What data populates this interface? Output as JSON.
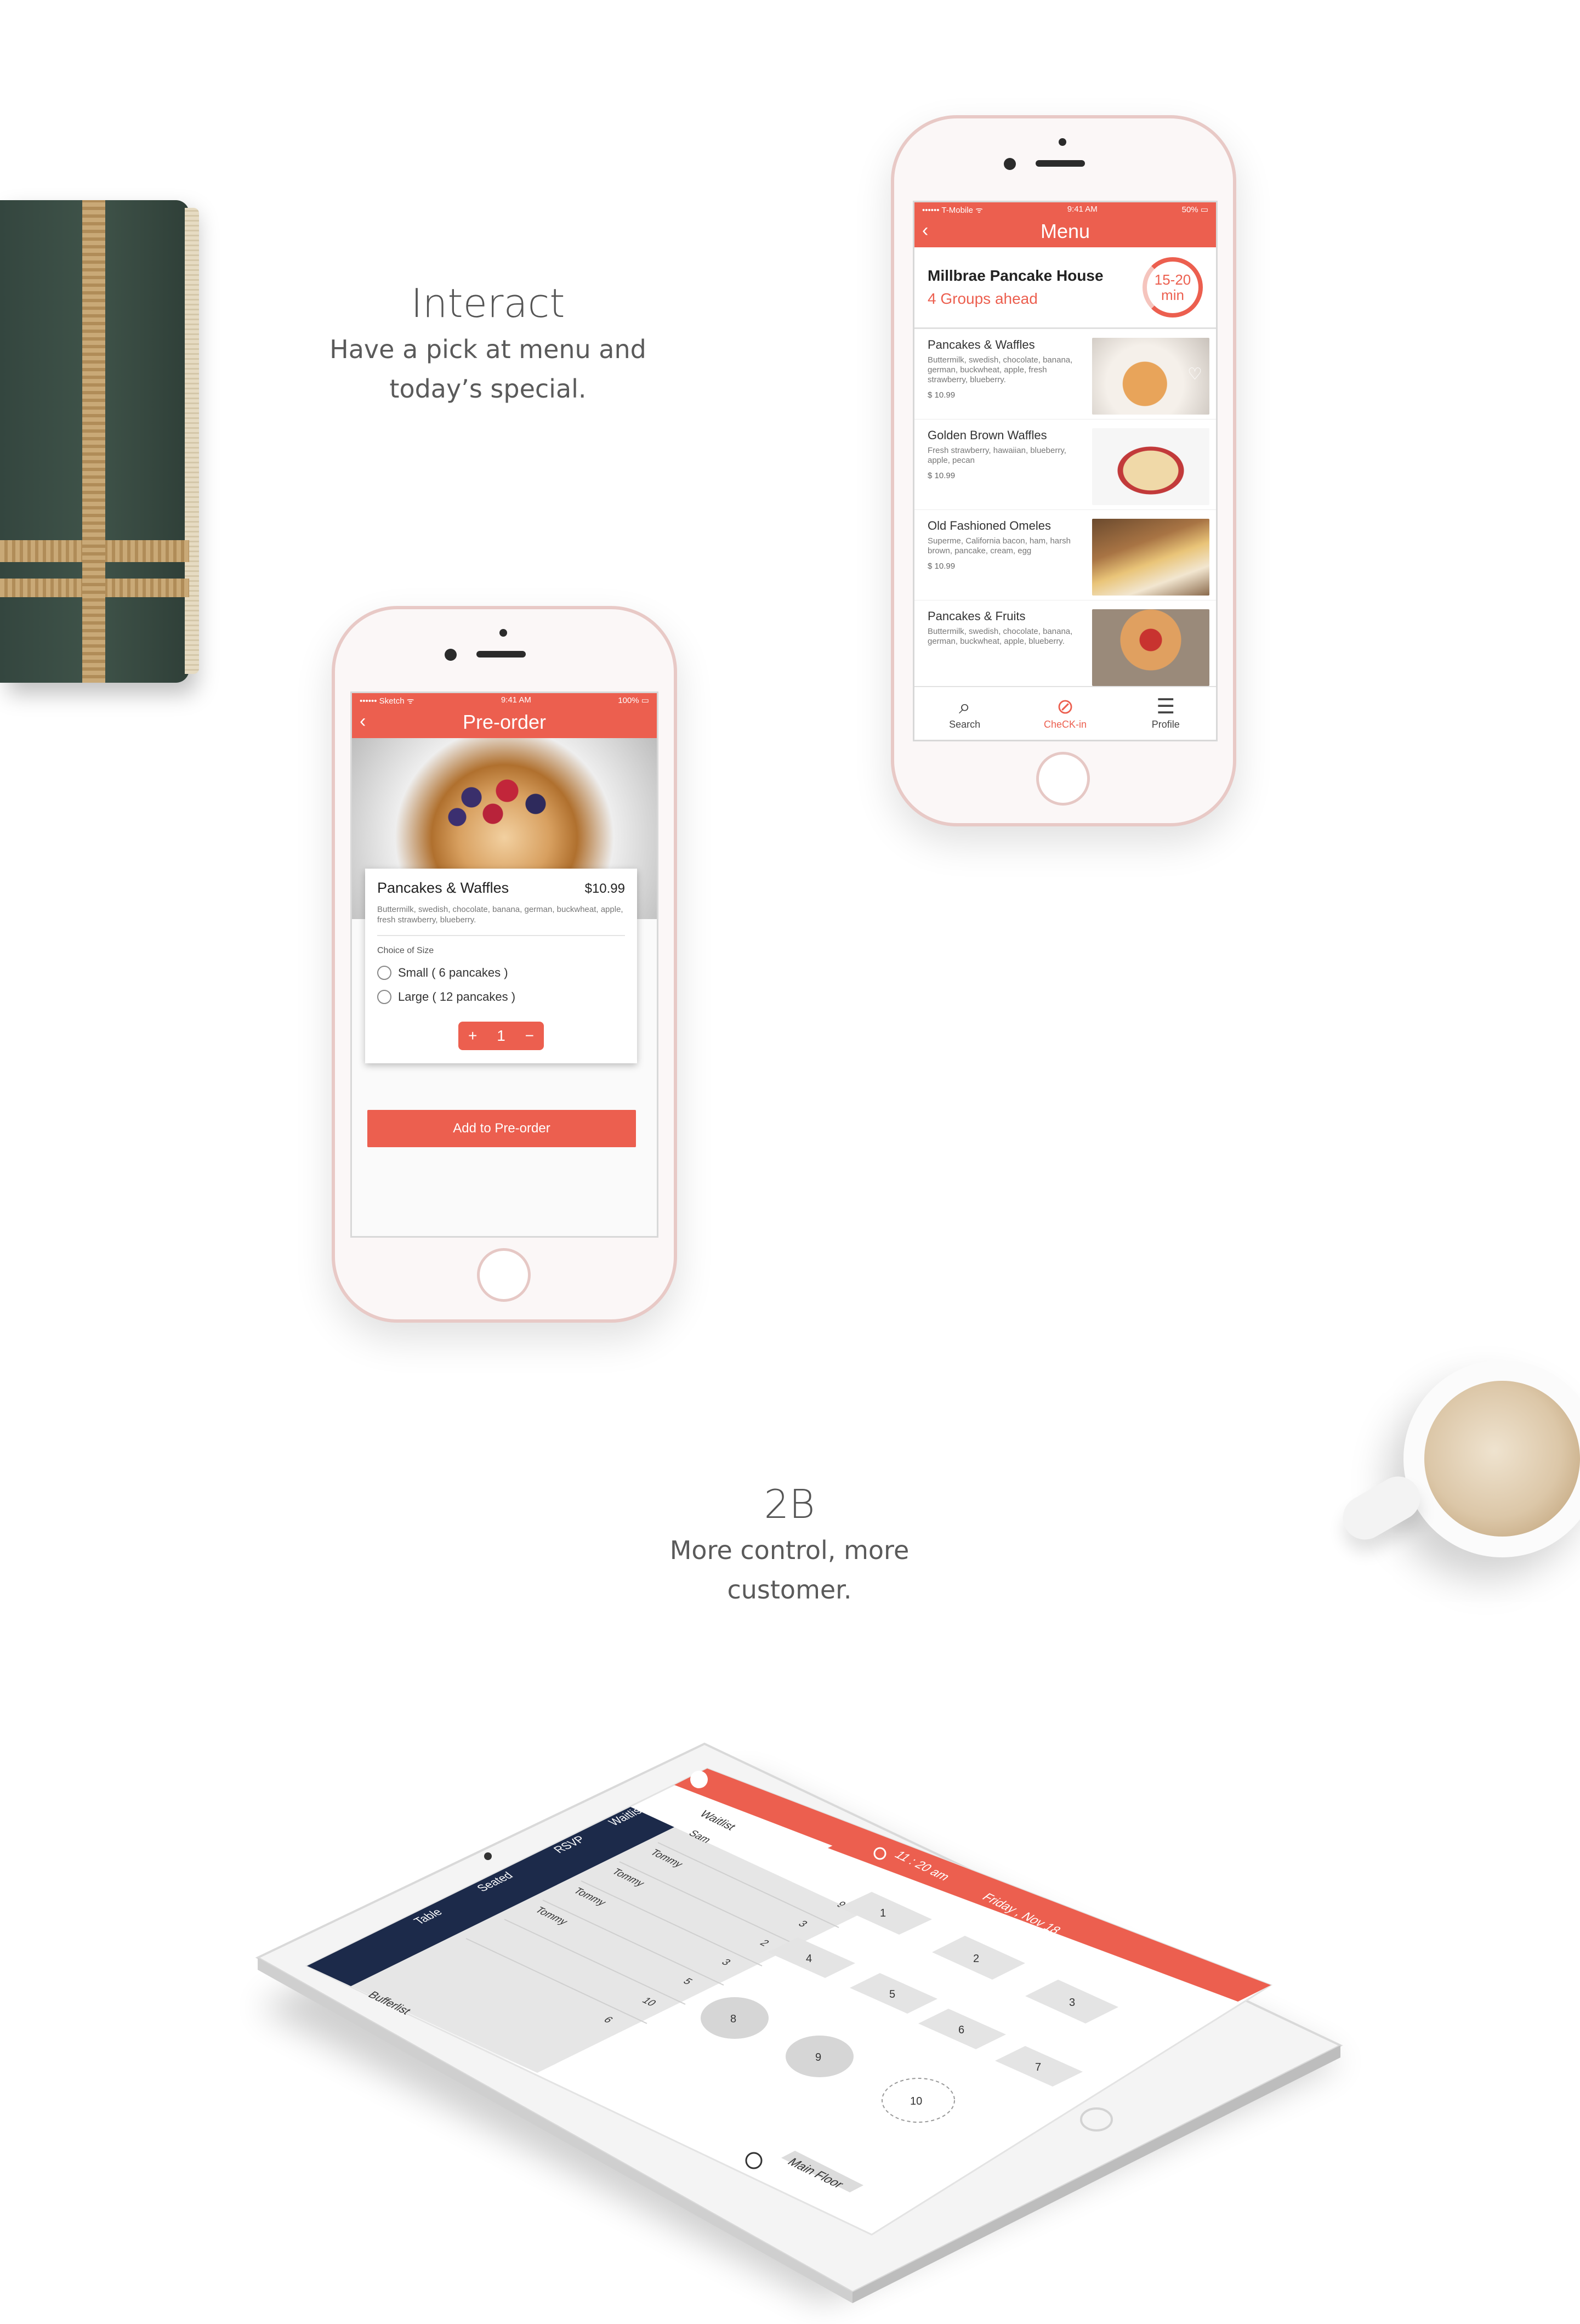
{
  "section1": {
    "title": "Interact",
    "subtitle_line1": "Have a pick at menu and",
    "subtitle_line2": "today’s special."
  },
  "section2": {
    "title": "2B",
    "subtitle_line1": "More control, more",
    "subtitle_line2": "customer."
  },
  "colors": {
    "accent": "#ec5f4f",
    "navy": "#1c2a4a",
    "background": "#ffffff"
  },
  "menu_screen": {
    "status": {
      "carrier": "•••••• T-Mobile ᯤ",
      "time": "9:41 AM",
      "battery": "50% ▭"
    },
    "title": "Menu",
    "back_icon": "chevron-left-icon",
    "restaurant": {
      "name": "Millbrae Pancake House",
      "groups": "4 Groups ahead",
      "wait_line1": "15-20",
      "wait_line2": "min"
    },
    "items": [
      {
        "name": "Pancakes & Waffles",
        "desc": "Buttermilk, swedish, chocolate, banana, german, buckwheat, apple, fresh strawberry, blueberry.",
        "price": "$ 10.99",
        "favorite": true
      },
      {
        "name": "Golden Brown Waffles",
        "desc": "Fresh strawberry, hawaiian, blueberry, apple, pecan",
        "price": "$ 10.99",
        "favorite": false
      },
      {
        "name": "Old Fashioned Omeles",
        "desc": "Superme, California bacon, ham, harsh brown, pancake, cream, egg",
        "price": "$ 10.99",
        "favorite": false
      },
      {
        "name": "Pancakes & Fruits",
        "desc": "Buttermilk, swedish, chocolate, banana, german, buckwheat, apple, blueberry.",
        "price": "",
        "favorite": false
      }
    ],
    "tabs": [
      {
        "label": "Search",
        "icon": "search-icon",
        "active": false
      },
      {
        "label": "CheCK-in",
        "icon": "check-circle-icon",
        "active": true
      },
      {
        "label": "Profile",
        "icon": "menu-lines-icon",
        "active": false
      }
    ]
  },
  "preorder_screen": {
    "status": {
      "carrier": "•••••• Sketch ᯤ",
      "time": "9:41 AM",
      "battery": "100% ▭"
    },
    "title": "Pre-order",
    "item_name": "Pancakes & Waffles",
    "item_price": "$10.99",
    "item_desc": "Buttermilk, swedish, chocolate, banana, german, buckwheat, apple, fresh strawberry, blueberry.",
    "choice_label": "Choice of Size",
    "options": [
      "Small ( 6 pancakes )",
      "Large ( 12 pancakes )"
    ],
    "stepper": {
      "plus": "+",
      "qty": "1",
      "minus": "−"
    },
    "add_button": "Add to Pre-order"
  },
  "ipad_screen": {
    "sidebar": [
      "Waitlist",
      "RSVP",
      "Seated",
      "Table"
    ],
    "list_header": "Waitlist",
    "list_rows": [
      {
        "name": "Sam",
        "size": "9"
      },
      {
        "name": "Tommy",
        "size": "3"
      },
      {
        "name": "Tommy",
        "size": "2"
      },
      {
        "name": "Tommy",
        "size": "3"
      },
      {
        "name": "Tommy",
        "size": "5"
      },
      {
        "name": "",
        "size": "10"
      },
      {
        "name": "",
        "size": "6"
      }
    ],
    "bufferlist": "Bufferlist",
    "time": "11 : 20 am",
    "date": "Friday , Nov 18",
    "tables": [
      "1",
      "2",
      "3",
      "4",
      "5",
      "6",
      "7",
      "8",
      "9",
      "10"
    ],
    "floor_label": "Main Floor"
  }
}
